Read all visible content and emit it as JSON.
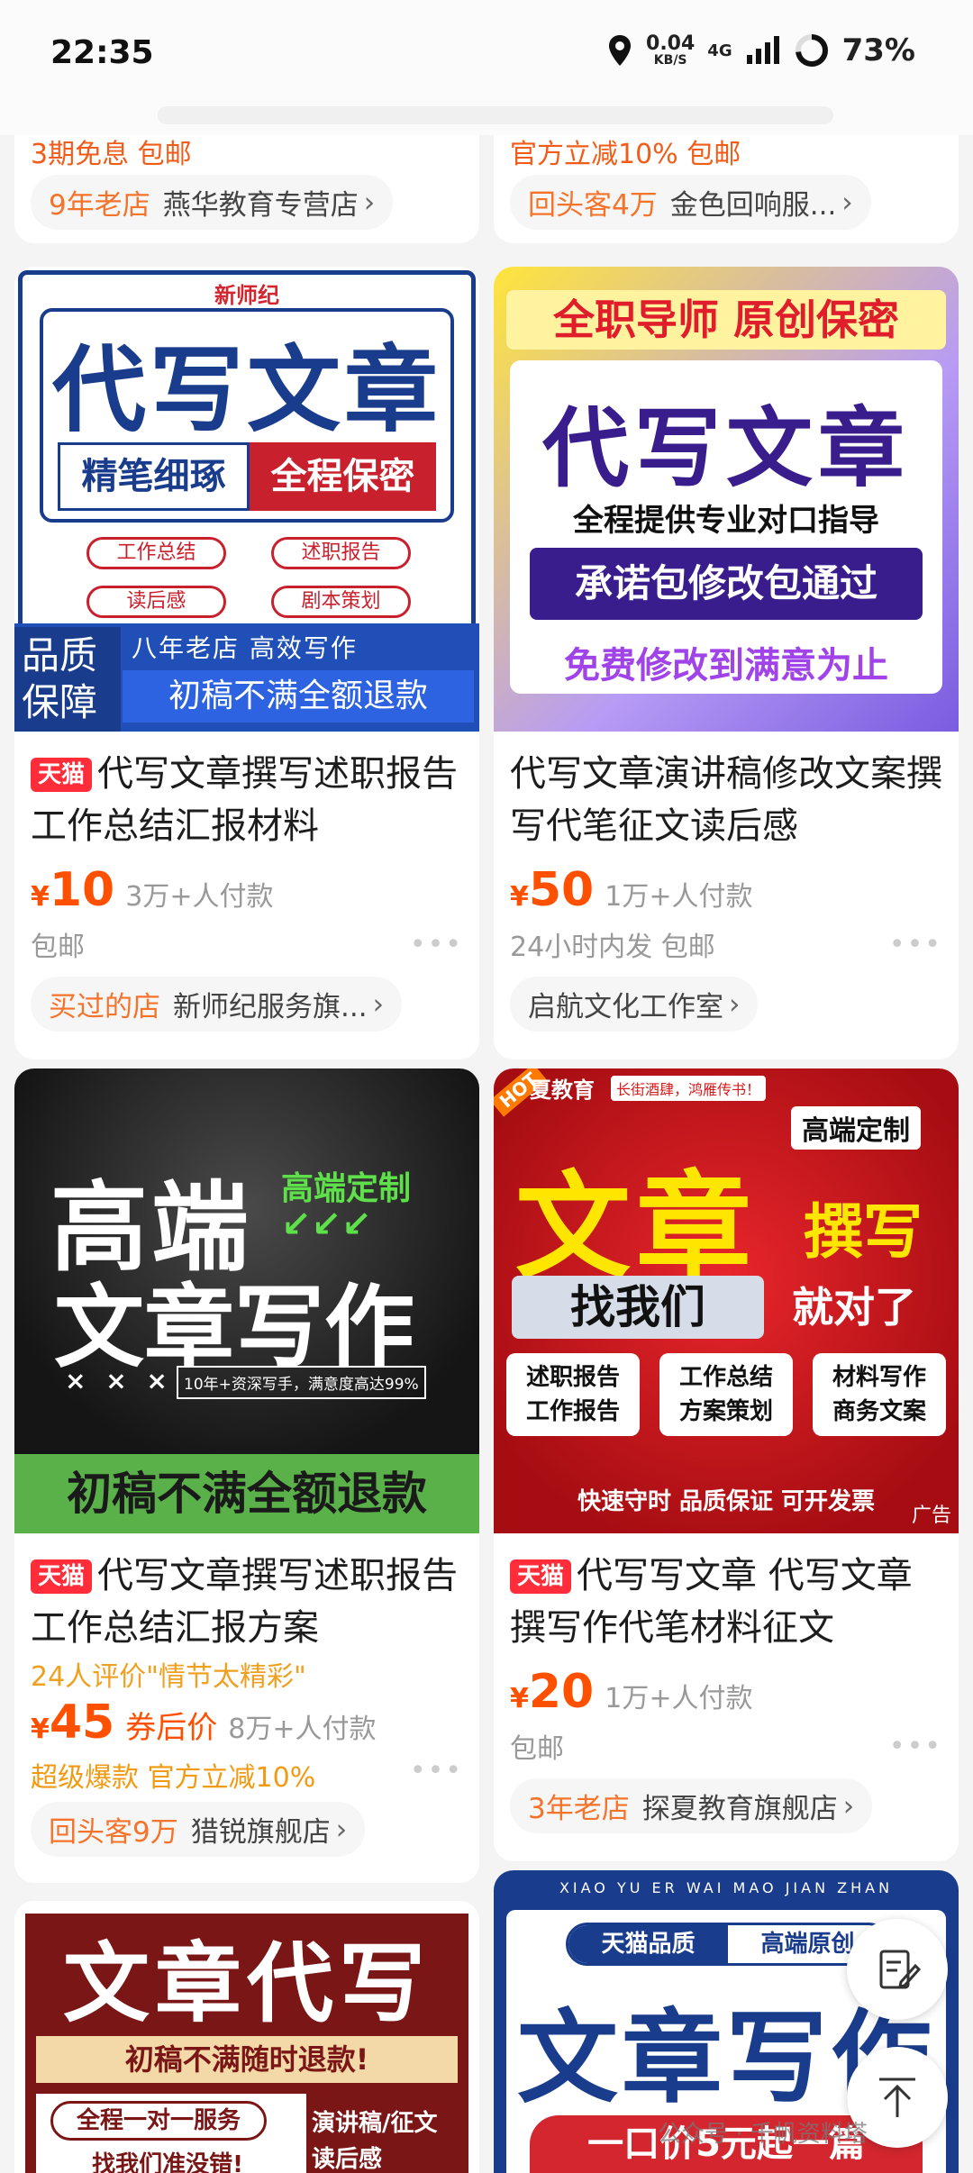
{
  "status_bar": {
    "time": "22:35",
    "net_speed": "0.04",
    "net_unit": "KB/S",
    "network": "4G",
    "battery": "73%",
    "icons": [
      "location-icon",
      "signal-icon",
      "battery-ring-icon"
    ]
  },
  "partial_top": {
    "left_text": "3期免息  包邮",
    "right_text": "官方立减10%  包邮",
    "left_shop": {
      "tag": "9年老店",
      "name": "燕华教育专营店",
      "chevron": "›"
    },
    "right_shop": {
      "tag": "回头客4万",
      "name": "金色回响服...",
      "chevron": "›"
    }
  },
  "products": [
    {
      "image": {
        "brand": "新师纪",
        "headline": "代写文章",
        "band_left": "精笔细琢",
        "band_right": "全程保密",
        "chips": [
          "工作总结",
          "述职报告",
          "读后感",
          "剧本策划"
        ],
        "quality": "品质保障",
        "store_years": "八年老店  高效写作",
        "refund": "初稿不满全额退款"
      },
      "badge": "天猫",
      "title": "代写文章撰写述职报告工作总结汇报材料",
      "currency": "¥",
      "price": "10",
      "sold": "3万+人付款",
      "meta": "包邮",
      "more": "•••",
      "shop": {
        "tag": "买过的店",
        "name": "新师纪服务旗...",
        "chevron": "›"
      }
    },
    {
      "image": {
        "top": "全职导师  原创保密",
        "headline": "代写文章",
        "subtitle": "全程提供专业对口指导",
        "band": "承诺包修改包通过",
        "bottom": "免费修改到满意为止"
      },
      "title": "代写文章演讲稿修改文案撰写代笔征文读后感",
      "currency": "¥",
      "price": "50",
      "sold": "1万+人付款",
      "meta": "24小时内发  包邮",
      "more": "•••",
      "shop": {
        "tag": "",
        "name": "启航文化工作室",
        "chevron": "›"
      }
    },
    {
      "image": {
        "line1": "高端",
        "line2": "文章写作",
        "side": "高端定制",
        "boxes": "× × ×",
        "note": "10年+资深写手，满意度高达99%",
        "bottom": "初稿不满全额退款"
      },
      "badge": "天猫",
      "title": "代写文章撰写述职报告工作总结汇报方案",
      "review": "24人评价\"情节太精彩\"",
      "currency": "¥",
      "price": "45",
      "coupon": "券后价",
      "sold": "8万+人付款",
      "promo": "超级爆款  官方立减10%",
      "more": "•••",
      "shop": {
        "tag": "回头客9万",
        "name": "猎锐旗舰店",
        "chevron": "›"
      }
    },
    {
      "image": {
        "hot": "HOT",
        "corner": "夏教育",
        "slogan": "长街酒肆，鸿雁传书！",
        "custom": "高端定制",
        "headline": "文章",
        "side": "撰写",
        "band_left": "找我们",
        "band_right": "就对了",
        "boxes": [
          [
            "述职报告",
            "工作报告"
          ],
          [
            "工作总结",
            "方案策划"
          ],
          [
            "材料写作",
            "商务文案"
          ]
        ],
        "footer": "快速守时  品质保证  可开发票",
        "ad": "广告"
      },
      "badge": "天猫",
      "title": "代写写文章  代写文章撰写作代笔材料征文",
      "currency": "¥",
      "price": "20",
      "sold": "1万+人付款",
      "meta": "包邮",
      "more": "•••",
      "shop": {
        "tag": "3年老店",
        "name": "探夏教育旗舰店",
        "chevron": "›"
      }
    },
    {
      "image": {
        "headline": "文章代写",
        "band": "初稿不满随时退款!",
        "left1": "全程一对一服务",
        "left2": "找我们准没错!",
        "right1": "演讲稿/征文",
        "right2": "读后感"
      }
    },
    {
      "image": {
        "marquee": "XIAO YU ER WAI MAO JIAN ZHAN",
        "pill_left": "天猫品质",
        "pill_right": "高端原创",
        "headline": "文章写作",
        "band": "一口价5元起一篇"
      }
    }
  ],
  "fabs": {
    "edit_icon": "edit-note-icon",
    "top_icon": "back-to-top-icon"
  },
  "watermark": "公众号 · 千帆资料塔"
}
